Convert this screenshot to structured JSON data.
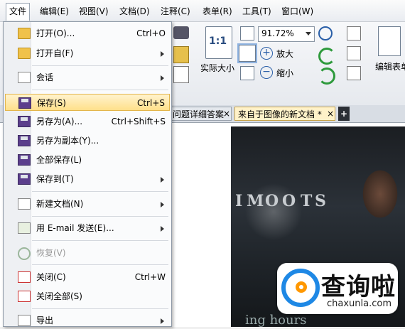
{
  "menubar": {
    "items": [
      "文件",
      "编辑(E)",
      "视图(V)",
      "文档(D)",
      "注释(C)",
      "表单(R)",
      "工具(T)",
      "窗口(W)"
    ]
  },
  "ribbon": {
    "zoom_value": "91.72%",
    "actual_size": "实际大小",
    "zoom_in": "放大",
    "zoom_out": "缩小",
    "edit_form": "编辑表单",
    "actual_size_icon_text": "1:1"
  },
  "tabs": [
    {
      "label": "问题详细答案",
      "close": "×"
    },
    {
      "label": "来自于图像的新文档 *",
      "close": "×"
    }
  ],
  "tab_add": "+",
  "file_menu": {
    "items": [
      {
        "label": "打开(O)...",
        "shortcut": "Ctrl+O",
        "icon": "folder-open-icon"
      },
      {
        "label": "打开自(F)",
        "shortcut": "",
        "icon": "folder-web-icon",
        "submenu": true
      },
      {
        "label": "会话",
        "shortcut": "",
        "icon": "session-icon",
        "submenu": true
      },
      {
        "label": "保存(S)",
        "shortcut": "Ctrl+S",
        "icon": "save-icon",
        "highlighted": true
      },
      {
        "label": "另存为(A)...",
        "shortcut": "Ctrl+Shift+S",
        "icon": "save-as-icon"
      },
      {
        "label": "另存为副本(Y)...",
        "shortcut": "",
        "icon": "save-copy-icon"
      },
      {
        "label": "全部保存(L)",
        "shortcut": "",
        "icon": "save-all-icon"
      },
      {
        "label": "保存到(T)",
        "shortcut": "",
        "icon": "save-to-icon",
        "submenu": true
      },
      {
        "label": "新建文档(N)",
        "shortcut": "",
        "icon": "new-document-icon",
        "submenu": true
      },
      {
        "label": "用 E-mail 发送(E)...",
        "shortcut": "",
        "icon": "email-icon",
        "submenu": true
      },
      {
        "label": "恢复(V)",
        "shortcut": "",
        "icon": "revert-icon",
        "disabled": true
      },
      {
        "label": "关闭(C)",
        "shortcut": "Ctrl+W",
        "icon": "close-doc-icon"
      },
      {
        "label": "关闭全部(S)",
        "shortcut": "",
        "icon": "close-all-icon"
      },
      {
        "label": "导出",
        "shortcut": "",
        "icon": "export-icon",
        "submenu": true
      }
    ]
  },
  "photo_sign_letters": [
    "I",
    "M",
    "O",
    "O",
    "T",
    "S"
  ],
  "photo_bottom_text": "ing hours",
  "watermark": {
    "title": "查询啦",
    "subtitle": "chaxunla.com"
  }
}
